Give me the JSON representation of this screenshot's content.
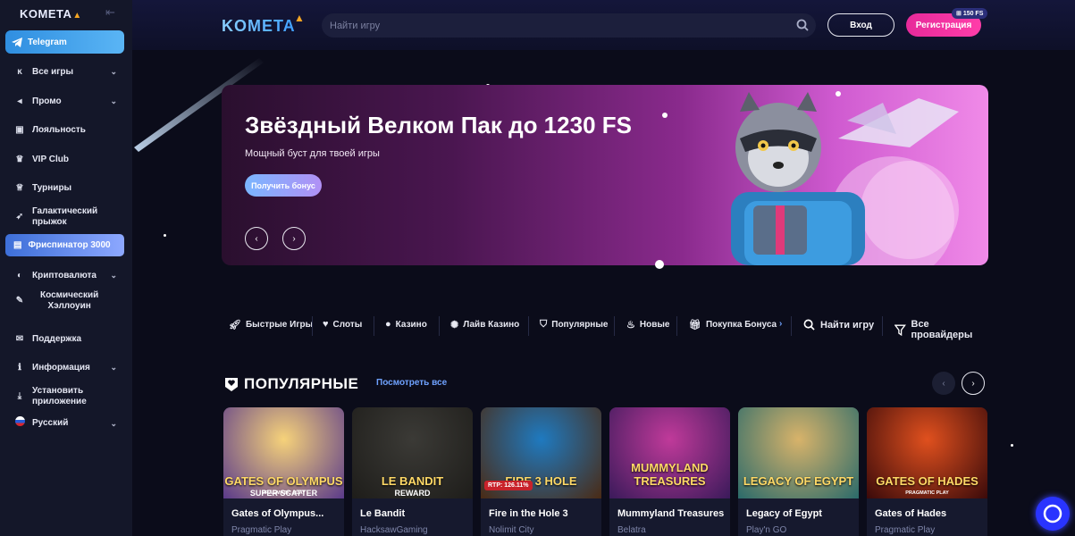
{
  "sidebar": {
    "logo": "KOMETA",
    "telegram": "Telegram",
    "items": [
      {
        "label": "Все игры",
        "icon": "lightning-icon",
        "chevron": true
      },
      {
        "label": "Промо",
        "icon": "megaphone-icon",
        "chevron": true
      },
      {
        "label": "Лояльность",
        "icon": "loyalty-icon",
        "chevron": false
      },
      {
        "label": "VIP Club",
        "icon": "crown-icon",
        "chevron": false
      },
      {
        "label": "Турниры",
        "icon": "trophy-icon",
        "chevron": false
      },
      {
        "label": "Галактический прыжок",
        "line1": "Галактический",
        "line2": "прыжок",
        "icon": "rocket-icon",
        "chevron": false
      },
      {
        "label": "Фриспинатор 3000",
        "icon": "calendar-icon",
        "chevron": false
      },
      {
        "label": "Криптовалюта",
        "icon": "crypto-icon",
        "chevron": true
      },
      {
        "label": "Космический Хэллоуин",
        "line1": "Космический",
        "line2": "Хэллоуин",
        "icon": "ticket-icon",
        "chevron": false
      },
      {
        "label": "Поддержка",
        "icon": "chat-icon",
        "chevron": false
      },
      {
        "label": "Информация",
        "icon": "info-icon",
        "chevron": true
      },
      {
        "label": "Установить приложение",
        "line1": "Установить",
        "line2": "приложение",
        "icon": "download-icon",
        "chevron": false
      },
      {
        "label": "Русский",
        "icon": "russia-flag-icon",
        "chevron": true
      }
    ]
  },
  "header": {
    "logo": "KOMETA",
    "search_placeholder": "Найти игру",
    "login": "Вход",
    "register": "Регистрация",
    "fs_badge": "150 FS"
  },
  "banner": {
    "title": "Звёздный Велком Пак до 1230 FS",
    "subtitle": "Мощный буст для твоей игры",
    "button": "Получить бонус",
    "prev": "‹",
    "next": "›"
  },
  "categories": [
    {
      "label": "Быстрые Игры",
      "icon": "rocket-icon"
    },
    {
      "label": "Слоты",
      "icon": "heart-icon"
    },
    {
      "label": "Казино",
      "icon": "poker-chip-icon"
    },
    {
      "label": "Лайв Казино",
      "icon": "roulette-icon"
    },
    {
      "label": "Популярные",
      "icon": "heart-shield-icon"
    },
    {
      "label": "Новые",
      "icon": "flame-icon"
    },
    {
      "label": "Покупка Бонуса",
      "icon": "gift-icon"
    },
    {
      "label": "Найти игру",
      "icon": "search-icon"
    },
    {
      "label": "Все провайдеры",
      "icon": "filter-icon"
    }
  ],
  "popular": {
    "title": "ПОПУЛЯРНЫЕ",
    "see_all": "Посмотреть все",
    "games": [
      {
        "name": "Gates of Olympus...",
        "provider": "Pragmatic Play",
        "art": "GATES OF OLYMPUS",
        "art_sub": "SUPER SCATTER",
        "art_prov": "PRAGMATIC PLAY",
        "c1": "#f6d27a",
        "c2": "#5a3a8a"
      },
      {
        "name": "Le Bandit",
        "provider": "HacksawGaming",
        "art": "LE BANDIT",
        "art_sub": "REWARD",
        "art_prov": "",
        "c1": "#3b3a36",
        "c2": "#1e1d1a"
      },
      {
        "name": "Fire in the Hole 3",
        "provider": "Nolimit City",
        "art": "FIRE 3 HOLE",
        "art_sub": "",
        "art_prov": "",
        "c1": "#1f7ac0",
        "c2": "#4a2a14",
        "rtp": "RTP: 126.11%"
      },
      {
        "name": "Mummyland Treasures",
        "provider": "Belatra",
        "art": "MUMMYLAND TREASURES",
        "art_sub": "",
        "art_prov": "",
        "c1": "#c03a9a",
        "c2": "#3a1a5a"
      },
      {
        "name": "Legacy of Egypt",
        "provider": "Play'n GO",
        "art": "LEGACY OF EGYPT",
        "art_sub": "",
        "art_prov": "",
        "c1": "#d8b36a",
        "c2": "#2a6a6a"
      },
      {
        "name": "Gates of Hades",
        "provider": "Pragmatic Play",
        "art": "GATES OF HADES",
        "art_sub": "",
        "art_prov": "PRAGMATIC PLAY",
        "c1": "#e0501e",
        "c2": "#3a0a0a"
      }
    ]
  }
}
